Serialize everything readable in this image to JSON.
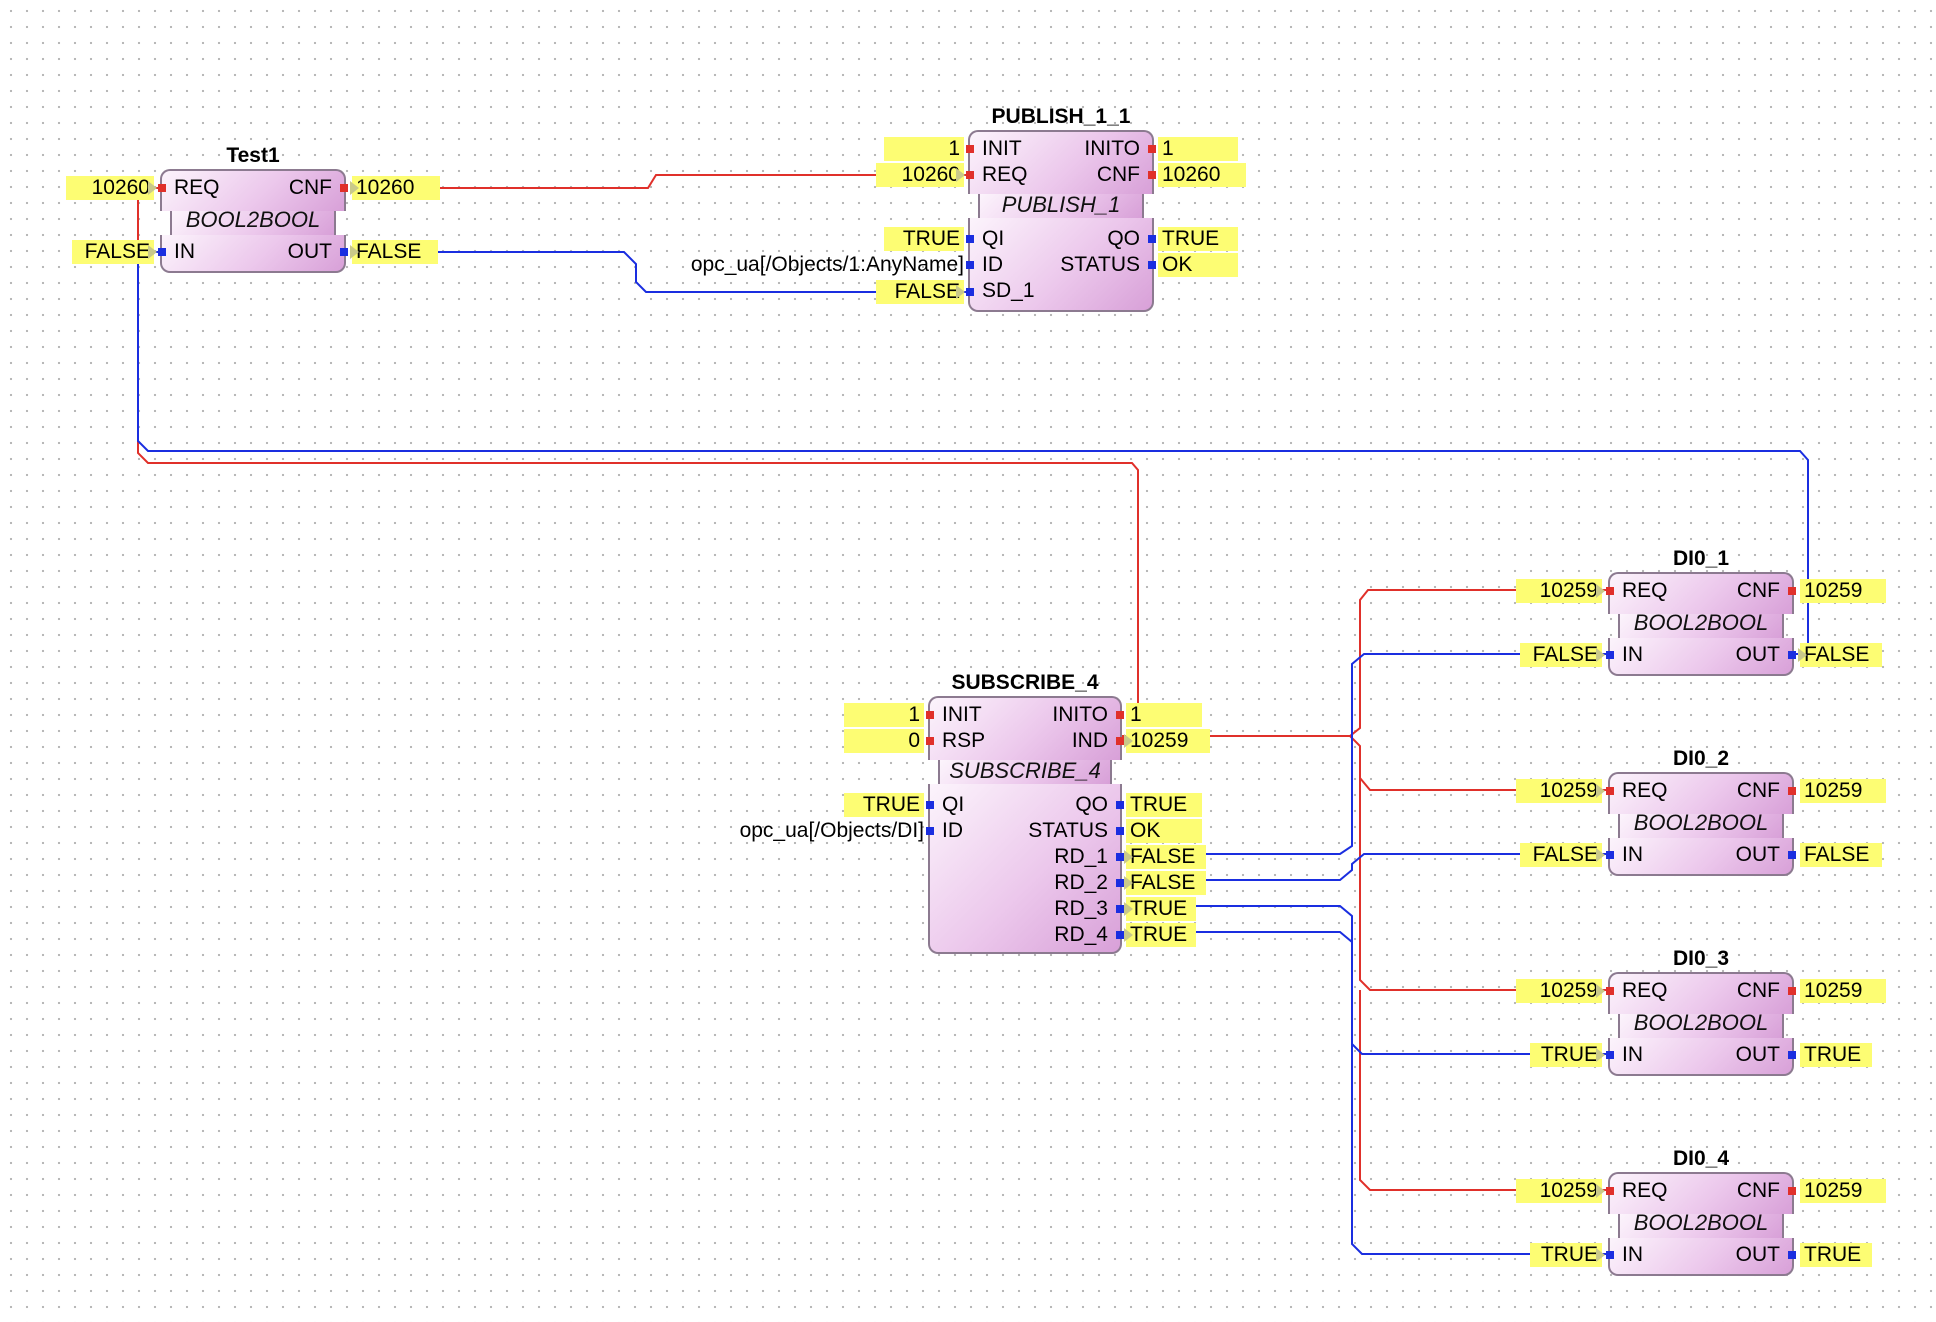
{
  "colors": {
    "event_wire": "#e0302a",
    "data_wire": "#1a2ee0",
    "value_highlight": "#fdfd73",
    "block_gradient_start": "#fcf4fc",
    "block_gradient_end": "#d8a0d8"
  },
  "blocks": {
    "test1": {
      "name": "Test1",
      "type": "BOOL2BOOL",
      "pins": {
        "req": "REQ",
        "cnf": "CNF",
        "in": "IN",
        "out": "OUT"
      },
      "values": {
        "req_in": "10260",
        "cnf_out": "10260",
        "in_in": "FALSE",
        "out_out": "FALSE"
      }
    },
    "publish": {
      "name": "PUBLISH_1_1",
      "type": "PUBLISH_1",
      "pins": {
        "init": "INIT",
        "req": "REQ",
        "inito": "INITO",
        "cnf": "CNF",
        "qi": "QI",
        "id": "ID",
        "sd1": "SD_1",
        "qo": "QO",
        "status": "STATUS"
      },
      "values": {
        "init_in": "1",
        "req_in": "10260",
        "inito_out": "1",
        "cnf_out": "10260",
        "qi_in": "TRUE",
        "id_in": "opc_ua[/Objects/1:AnyName]",
        "sd1_in": "FALSE",
        "qo_out": "TRUE",
        "status_out": "OK"
      }
    },
    "subscribe": {
      "name": "SUBSCRIBE_4",
      "type": "SUBSCRIBE_4",
      "pins": {
        "init": "INIT",
        "rsp": "RSP",
        "inito": "INITO",
        "ind": "IND",
        "qi": "QI",
        "id": "ID",
        "qo": "QO",
        "status": "STATUS",
        "rd1": "RD_1",
        "rd2": "RD_2",
        "rd3": "RD_3",
        "rd4": "RD_4"
      },
      "values": {
        "init_in": "1",
        "rsp_in": "0",
        "inito_out": "1",
        "ind_out": "10259",
        "qi_in": "TRUE",
        "id_in": "opc_ua[/Objects/DI]",
        "qo_out": "TRUE",
        "status_out": "OK",
        "rd1_out": "FALSE",
        "rd2_out": "FALSE",
        "rd3_out": "TRUE",
        "rd4_out": "TRUE"
      }
    },
    "dio1": {
      "name": "DI0_1",
      "type": "BOOL2BOOL",
      "pins": {
        "req": "REQ",
        "cnf": "CNF",
        "in": "IN",
        "out": "OUT"
      },
      "values": {
        "req_in": "10259",
        "cnf_out": "10259",
        "in_in": "FALSE",
        "out_out": "FALSE"
      }
    },
    "dio2": {
      "name": "DI0_2",
      "type": "BOOL2BOOL",
      "pins": {
        "req": "REQ",
        "cnf": "CNF",
        "in": "IN",
        "out": "OUT"
      },
      "values": {
        "req_in": "10259",
        "cnf_out": "10259",
        "in_in": "FALSE",
        "out_out": "FALSE"
      }
    },
    "dio3": {
      "name": "DI0_3",
      "type": "BOOL2BOOL",
      "pins": {
        "req": "REQ",
        "cnf": "CNF",
        "in": "IN",
        "out": "OUT"
      },
      "values": {
        "req_in": "10259",
        "cnf_out": "10259",
        "in_in": "TRUE",
        "out_out": "TRUE"
      }
    },
    "dio4": {
      "name": "DI0_4",
      "type": "BOOL2BOOL",
      "pins": {
        "req": "REQ",
        "cnf": "CNF",
        "in": "IN",
        "out": "OUT"
      },
      "values": {
        "req_in": "10259",
        "cnf_out": "10259",
        "in_in": "TRUE",
        "out_out": "TRUE"
      }
    }
  }
}
